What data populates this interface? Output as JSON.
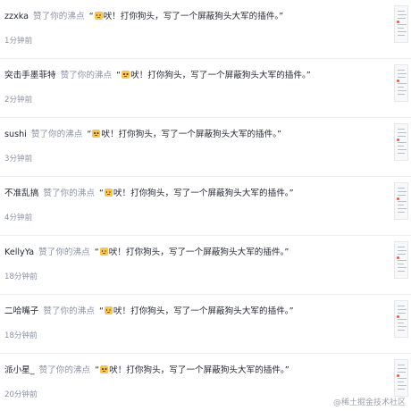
{
  "notifications": [
    {
      "user": "zzxka",
      "action": "赞了你的沸点",
      "quote_open": "“",
      "quote_text": "吠！打你狗头，写了一个屏蔽狗头大军的插件。”",
      "time": "1分钟前"
    },
    {
      "user": "突击手墨菲特",
      "action": "赞了你的沸点",
      "quote_open": "“",
      "quote_text": "吠！打你狗头，写了一个屏蔽狗头大军的插件。”",
      "time": "2分钟前"
    },
    {
      "user": "sushi",
      "action": "赞了你的沸点",
      "quote_open": "“",
      "quote_text": "吠！打你狗头，写了一个屏蔽狗头大军的插件。”",
      "time": "3分钟前"
    },
    {
      "user": "不准乱搞",
      "action": "赞了你的沸点",
      "quote_open": "“",
      "quote_text": "吠！打你狗头，写了一个屏蔽狗头大军的插件。”",
      "time": "4分钟前"
    },
    {
      "user": "KellyYa",
      "action": "赞了你的沸点",
      "quote_open": "“",
      "quote_text": "吠！打你狗头，写了一个屏蔽狗头大军的插件。”",
      "time": "18分钟前"
    },
    {
      "user": "二哈嘴子",
      "action": "赞了你的沸点",
      "quote_open": "“",
      "quote_text": "吠！打你狗头，写了一个屏蔽狗头大军的插件。”",
      "time": "18分钟前"
    },
    {
      "user": "派小星_",
      "action": "赞了你的沸点",
      "quote_open": "“",
      "quote_text": "吠！打你狗头，写了一个屏蔽狗头大军的插件。”",
      "time": "20分钟前"
    }
  ],
  "emoji_icon": "dog-head-emoji-icon",
  "watermark": "@稀土掘金技术社区"
}
